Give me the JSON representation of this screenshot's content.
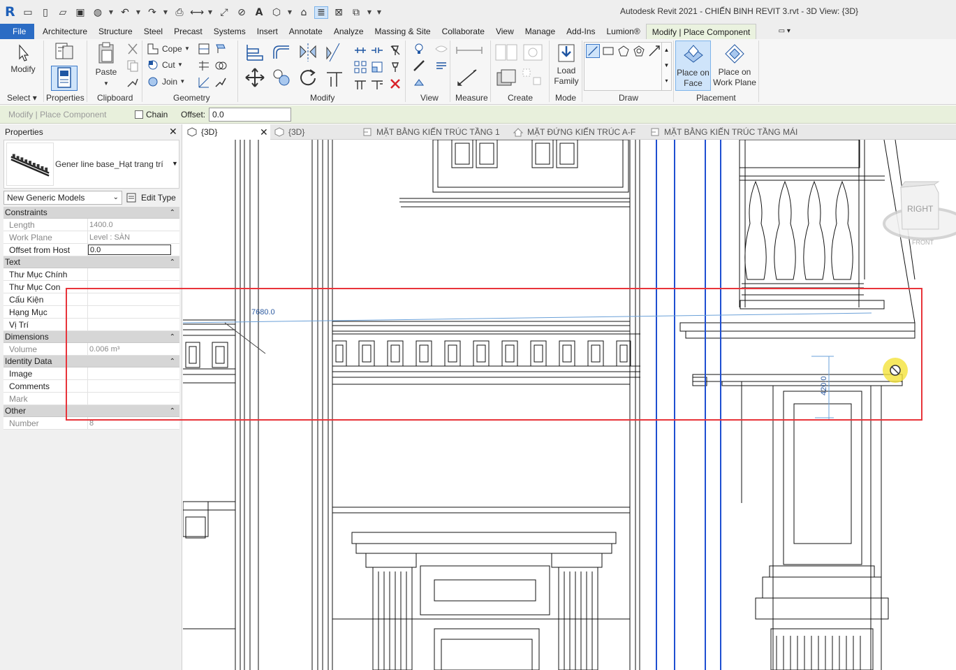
{
  "app": {
    "logo": "R",
    "window_title": "Autodesk Revit 2021 - CHIẾN BINH REVIT 3.rvt - 3D View: {3D}"
  },
  "ribbon_tabs": [
    "File",
    "Architecture",
    "Structure",
    "Steel",
    "Precast",
    "Systems",
    "Insert",
    "Annotate",
    "Analyze",
    "Massing & Site",
    "Collaborate",
    "View",
    "Manage",
    "Add-Ins",
    "Lumion®",
    "Modify | Place Component"
  ],
  "ribbon": {
    "modify": "Modify",
    "properties": "Properties",
    "paste": "Paste",
    "cope": "Cope",
    "cut": "Cut",
    "join": "Join",
    "load_family_1": "Load",
    "load_family_2": "Family",
    "place_on_face_1": "Place on",
    "place_on_face_2": "Face",
    "place_on_wp_1": "Place on",
    "place_on_wp_2": "Work Plane",
    "panels": {
      "select": "Select",
      "properties": "Properties",
      "clipboard": "Clipboard",
      "geometry": "Geometry",
      "modify": "Modify",
      "view": "View",
      "measure": "Measure",
      "create": "Create",
      "mode": "Mode",
      "draw": "Draw",
      "placement": "Placement"
    }
  },
  "options_bar": {
    "context": "Modify | Place Component",
    "chain": "Chain",
    "offset_label": "Offset:",
    "offset_value": "0.0"
  },
  "properties": {
    "title": "Properties",
    "type_name": "Gener line base_Hạt trang trí",
    "selector": "New Generic Models",
    "edit_type": "Edit Type",
    "categories": [
      {
        "name": "Constraints",
        "rows": [
          {
            "k": "Length",
            "v": "1400.0",
            "dim": true
          },
          {
            "k": "Work Plane",
            "v": "Level : SÀN",
            "dim": true
          },
          {
            "k": "Offset from Host",
            "v": "0.0",
            "edit": true
          }
        ]
      },
      {
        "name": "Text",
        "rows": [
          {
            "k": "Thư Mục Chính",
            "v": ""
          },
          {
            "k": "Thư Mục Con",
            "v": ""
          },
          {
            "k": "Cấu Kiện",
            "v": ""
          },
          {
            "k": "Hạng Mục",
            "v": ""
          },
          {
            "k": "Vị Trí",
            "v": ""
          }
        ]
      },
      {
        "name": "Dimensions",
        "rows": [
          {
            "k": "Volume",
            "v": "0.006 m³",
            "dim": true
          }
        ]
      },
      {
        "name": "Identity Data",
        "rows": [
          {
            "k": "Image",
            "v": ""
          },
          {
            "k": "Comments",
            "v": ""
          },
          {
            "k": "Mark",
            "v": "",
            "dim": true
          }
        ]
      },
      {
        "name": "Other",
        "rows": [
          {
            "k": "Number",
            "v": "8",
            "dim": true
          }
        ]
      }
    ]
  },
  "view_tabs": [
    {
      "label": "{3D}",
      "icon": "3d-view-icon",
      "active": true
    },
    {
      "label": "{3D}",
      "icon": "3d-view-icon",
      "active": false
    },
    {
      "label": "MẶT BẰNG KIẾN TRÚC TẦNG 1",
      "icon": "floor-plan-icon",
      "active": false
    },
    {
      "label": "MẶT ĐỨNG KIẾN TRÚC A-F",
      "icon": "elevation-icon",
      "active": false
    },
    {
      "label": "MẶT BẰNG KIẾN TRÚC TẦNG MÁI",
      "icon": "floor-plan-icon",
      "active": false
    }
  ],
  "canvas": {
    "dim_label_1": "7680.0",
    "dim_label_2": "420.0",
    "viewcube_face": "RIGHT",
    "viewcube_ring": "FRONT"
  },
  "colors": {
    "file_tab": "#2b6cc4",
    "context_tab": "#eaf2df",
    "selection_blue": "#1f4fd1",
    "highlight_red": "#e8343a",
    "cursor_yellow": "#f4e23a"
  }
}
